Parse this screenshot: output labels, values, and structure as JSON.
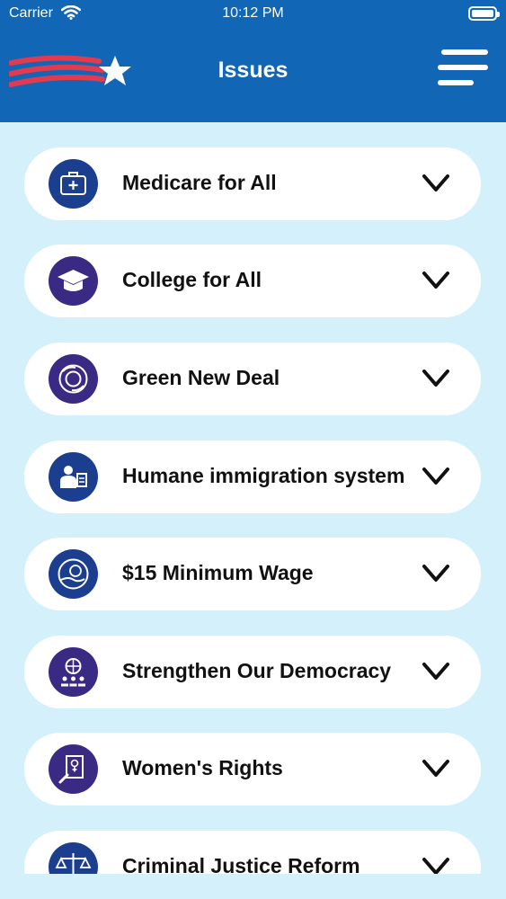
{
  "status_bar": {
    "carrier": "Carrier",
    "time": "10:12 PM"
  },
  "header": {
    "title": "Issues"
  },
  "colors": {
    "header": "#1166b5",
    "background": "#d3f0fb",
    "icon_blue": "#1b3e8f",
    "icon_purple": "#3b2a84"
  },
  "issues": [
    {
      "label": "Medicare for All",
      "icon": "medical-kit-icon"
    },
    {
      "label": "College for All",
      "icon": "graduation-cap-icon"
    },
    {
      "label": "Green New Deal",
      "icon": "earth-icon"
    },
    {
      "label": "Humane immigration system",
      "icon": "immigration-officer-icon"
    },
    {
      "label": "$15 Minimum Wage",
      "icon": "money-hand-icon"
    },
    {
      "label": "Strengthen Our Democracy",
      "icon": "democracy-people-icon"
    },
    {
      "label": "Women's Rights",
      "icon": "womens-rights-icon"
    },
    {
      "label": "Criminal Justice Reform",
      "icon": "scales-of-justice-icon"
    }
  ]
}
